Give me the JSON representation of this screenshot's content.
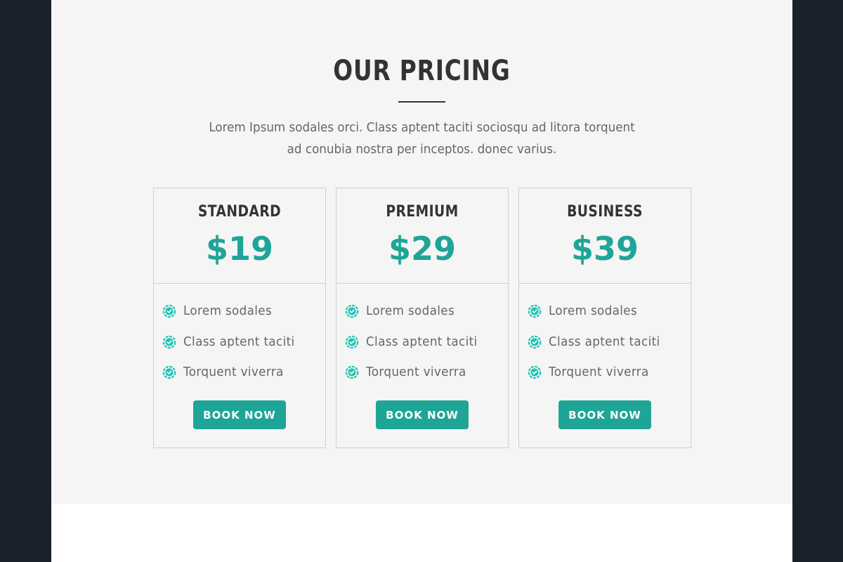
{
  "pricing": {
    "title": "OUR PRICING",
    "description": "Lorem Ipsum sodales orci. Class aptent taciti sociosqu ad litora torquent ad conubia nostra per inceptos. donec varius.",
    "accent_color": "#1ea597",
    "plans": [
      {
        "name": "STANDARD",
        "price": "$19",
        "features": [
          "Lorem sodales",
          "Class aptent taciti",
          "Torquent viverra"
        ],
        "button_label": "BOOK NOW"
      },
      {
        "name": "PREMIUM",
        "price": "$29",
        "features": [
          "Lorem sodales",
          "Class aptent taciti",
          "Torquent viverra"
        ],
        "button_label": "BOOK NOW"
      },
      {
        "name": "BUSINESS",
        "price": "$39",
        "features": [
          "Lorem sodales",
          "Class aptent taciti",
          "Torquent viverra"
        ],
        "button_label": "BOOK NOW"
      }
    ],
    "feature_icon": "check-circle-icon"
  }
}
